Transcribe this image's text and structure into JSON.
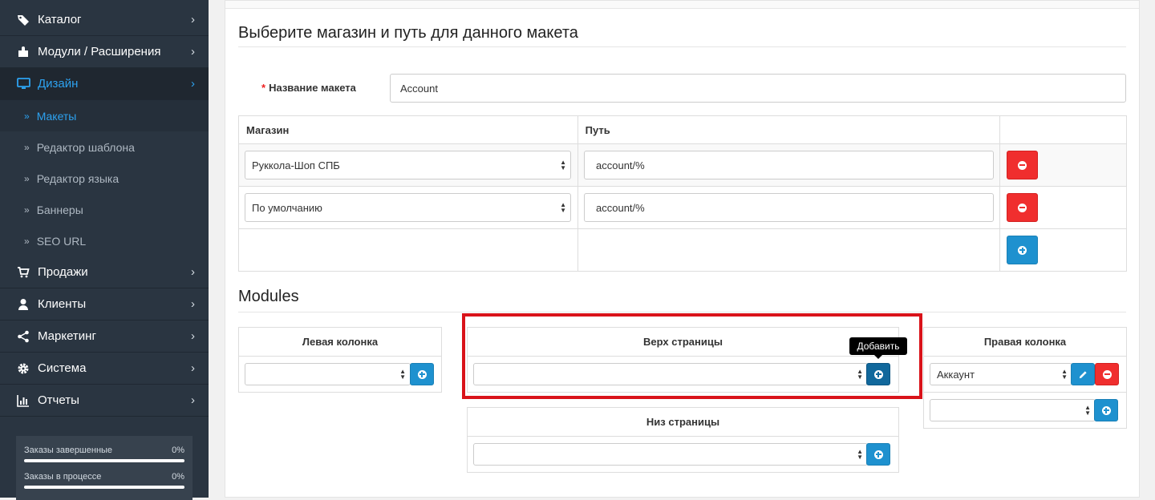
{
  "sidebar": {
    "menu": [
      {
        "label": "Каталог",
        "icon": "tag-icon",
        "name": "sidebar-item-catalog"
      },
      {
        "label": "Модули / Расширения",
        "icon": "puzzle-icon",
        "name": "sidebar-item-modules"
      },
      {
        "label": "Дизайн",
        "icon": "monitor-icon",
        "name": "sidebar-item-design",
        "active": true
      }
    ],
    "design_sub": [
      "Макеты",
      "Редактор шаблона",
      "Редактор языка",
      "Баннеры",
      "SEO URL"
    ],
    "menu_after": [
      {
        "label": "Продажи",
        "icon": "cart-icon",
        "name": "sidebar-item-sales"
      },
      {
        "label": "Клиенты",
        "icon": "user-icon",
        "name": "sidebar-item-customers"
      },
      {
        "label": "Маркетинг",
        "icon": "share-icon",
        "name": "sidebar-item-marketing"
      },
      {
        "label": "Система",
        "icon": "gear-icon",
        "name": "sidebar-item-system"
      },
      {
        "label": "Отчеты",
        "icon": "bar-chart-icon",
        "name": "sidebar-item-reports"
      }
    ],
    "stats": [
      {
        "label": "Заказы завершенные",
        "value": "0%",
        "progress": 0
      },
      {
        "label": "Заказы в процессе",
        "value": "0%",
        "progress": 0
      }
    ]
  },
  "main": {
    "store_section_title": "Выберите магазин и путь для данного макета",
    "layout_name_label": "Название макета",
    "layout_name_value": "Account",
    "table_headers": {
      "store": "Магазин",
      "route": "Путь"
    },
    "routes": [
      {
        "store": "Руккола-Шоп СПБ",
        "route": "account/%"
      },
      {
        "store": "По умолчанию",
        "route": "account/%"
      }
    ],
    "modules_title": "Modules",
    "column_left": "Левая колонка",
    "content_top": "Верх страницы",
    "content_bottom": "Низ страницы",
    "column_right": "Правая колонка",
    "right_module_selected": "Аккаунт",
    "add_tooltip": "Добавить"
  },
  "colors": {
    "accent": "#1e91cf",
    "danger": "#f02e2e",
    "sidebar_bg": "#2a3541",
    "highlight_frame": "#d9131a"
  }
}
